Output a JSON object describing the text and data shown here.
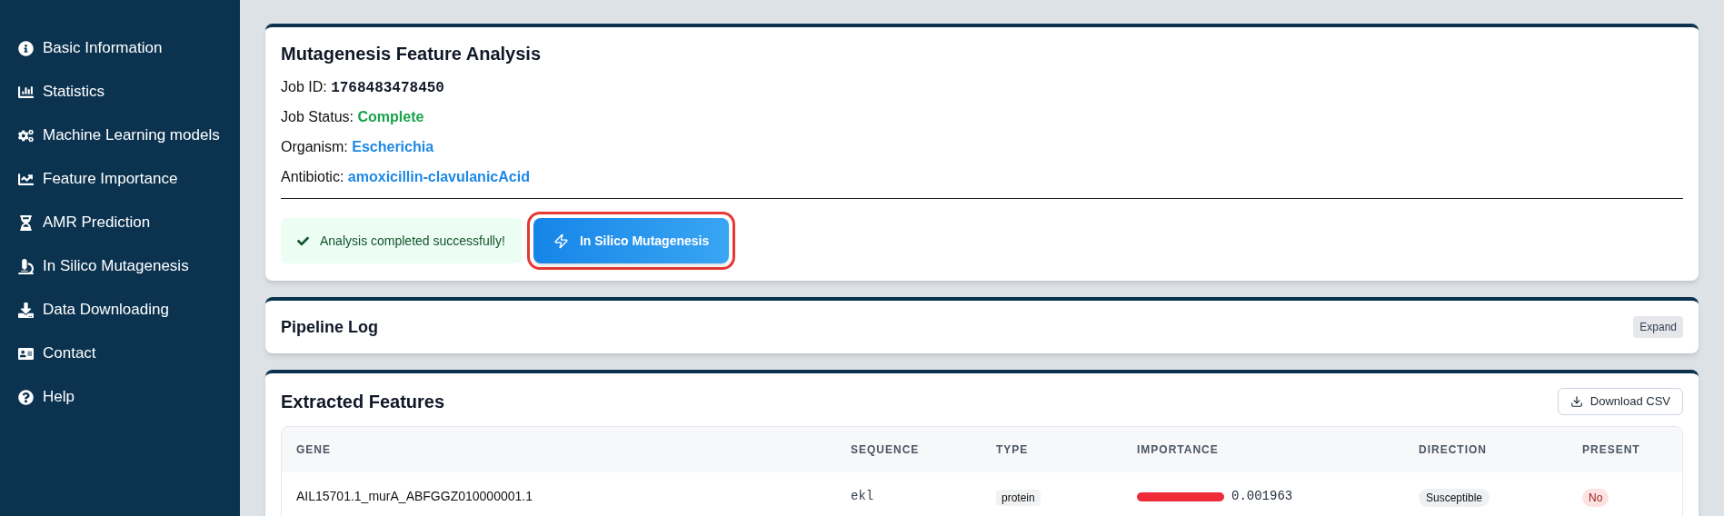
{
  "sidebar": {
    "items": [
      {
        "label": "Basic Information"
      },
      {
        "label": "Statistics"
      },
      {
        "label": "Machine Learning models"
      },
      {
        "label": "Feature Importance"
      },
      {
        "label": "AMR Prediction"
      },
      {
        "label": "In Silico Mutagenesis"
      },
      {
        "label": "Data Downloading"
      },
      {
        "label": "Contact"
      },
      {
        "label": "Help"
      }
    ]
  },
  "analysis_card": {
    "title": "Mutagenesis Feature Analysis",
    "fields": [
      {
        "label": "Job ID:",
        "value": "1768483478450",
        "kind": "mono"
      },
      {
        "label": "Job Status:",
        "value": "Complete",
        "kind": "status"
      },
      {
        "label": "Organism:",
        "value": "Escherichia",
        "kind": "link"
      },
      {
        "label": "Antibiotic:",
        "value": "amoxicillin-clavulanicAcid",
        "kind": "link"
      }
    ],
    "alert": "Analysis completed successfully!",
    "button": "In Silico Mutagenesis",
    "highlighted": true
  },
  "pipeline_log": {
    "title": "Pipeline Log",
    "button": "Expand"
  },
  "features": {
    "title": "Extracted Features",
    "download_button": "Download CSV",
    "table": {
      "columns": [
        "GENE",
        "SEQUENCE",
        "TYPE",
        "IMPORTANCE",
        "DIRECTION",
        "PRESENT"
      ],
      "rows": [
        {
          "gene": "AIL15701.1_murA_ABFGGZ010000001.1",
          "sequence": "ekl",
          "type": "protein",
          "level": 1,
          "importance": "0.001963",
          "direction": "Susceptible",
          "present": "No",
          "present_flag": false
        }
      ]
    }
  }
}
